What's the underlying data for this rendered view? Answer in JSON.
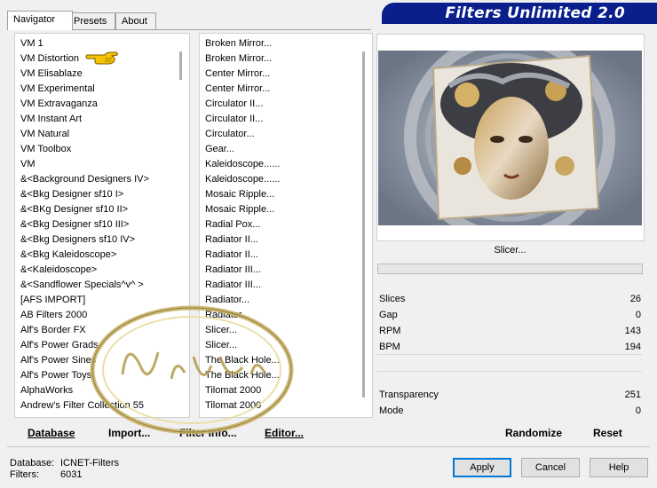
{
  "tabs": [
    {
      "label": "Navigator"
    },
    {
      "label": "Presets"
    },
    {
      "label": "About"
    }
  ],
  "banner": {
    "title": "Filters Unlimited 2.0"
  },
  "categories": [
    {
      "label": "VM 1"
    },
    {
      "label": "VM Distortion"
    },
    {
      "label": "VM Elisablaze"
    },
    {
      "label": "VM Experimental"
    },
    {
      "label": "VM Extravaganza"
    },
    {
      "label": "VM Instant Art"
    },
    {
      "label": "VM Natural"
    },
    {
      "label": "VM Toolbox"
    },
    {
      "label": "VM"
    },
    {
      "label": "&<Background Designers IV>"
    },
    {
      "label": "&<Bkg Designer sf10 I>"
    },
    {
      "label": "&<BKg Designer sf10 II>"
    },
    {
      "label": "&<Bkg Designer sf10 III>"
    },
    {
      "label": "&<Bkg Designers sf10 IV>"
    },
    {
      "label": "&<Bkg Kaleidoscope>"
    },
    {
      "label": "&<Kaleidoscope>"
    },
    {
      "label": "&<Sandflower Specials^v^ >"
    },
    {
      "label": "[AFS IMPORT]"
    },
    {
      "label": "AB Filters 2000"
    },
    {
      "label": "Alf's Border FX"
    },
    {
      "label": "Alf's Power Grads"
    },
    {
      "label": "Alf's Power Sines"
    },
    {
      "label": "Alf's Power Toys"
    },
    {
      "label": "AlphaWorks"
    },
    {
      "label": "Andrew's Filter Collection 55"
    }
  ],
  "filters": [
    {
      "label": "Broken Mirror..."
    },
    {
      "label": "Broken Mirror..."
    },
    {
      "label": "Center Mirror..."
    },
    {
      "label": "Center Mirror..."
    },
    {
      "label": "Circulator II..."
    },
    {
      "label": "Circulator II..."
    },
    {
      "label": "Circulator..."
    },
    {
      "label": "Gear..."
    },
    {
      "label": "Kaleidoscope......"
    },
    {
      "label": "Kaleidoscope......"
    },
    {
      "label": "Mosaic Ripple..."
    },
    {
      "label": "Mosaic Ripple..."
    },
    {
      "label": "Radial Pox..."
    },
    {
      "label": "Radiator II..."
    },
    {
      "label": "Radiator II..."
    },
    {
      "label": "Radiator III..."
    },
    {
      "label": "Radiator III..."
    },
    {
      "label": "Radiator..."
    },
    {
      "label": "Radiator..."
    },
    {
      "label": "Slicer..."
    },
    {
      "label": "Slicer..."
    },
    {
      "label": "The Black Hole..."
    },
    {
      "label": "The Black Hole..."
    },
    {
      "label": "Tilomat 2000"
    },
    {
      "label": "Tilomat 2000"
    }
  ],
  "filter_name": "Slicer...",
  "params": [
    {
      "label": "Slices",
      "value": "26"
    },
    {
      "label": "Gap",
      "value": "0"
    },
    {
      "label": "RPM",
      "value": "143"
    },
    {
      "label": "BPM",
      "value": "194"
    },
    {
      "label": "Transparency",
      "value": "251"
    },
    {
      "label": "Mode",
      "value": "0"
    }
  ],
  "toolbar": {
    "database": "Database",
    "import": "Import...",
    "filter_info": "Filter Info...",
    "editor": "Editor...",
    "randomize": "Randomize",
    "reset": "Reset"
  },
  "status": {
    "database_label": "Database:",
    "database_value": "ICNET-Filters",
    "filters_label": "Filters:",
    "filters_value": "6031"
  },
  "buttons": {
    "apply": "Apply",
    "cancel": "Cancel",
    "help": "Help"
  },
  "watermark": {
    "text": "Noise Gila"
  },
  "colors": {
    "banner": "#0a1e8c",
    "pointer": "#f5c400",
    "default_border": "#0078d7"
  }
}
